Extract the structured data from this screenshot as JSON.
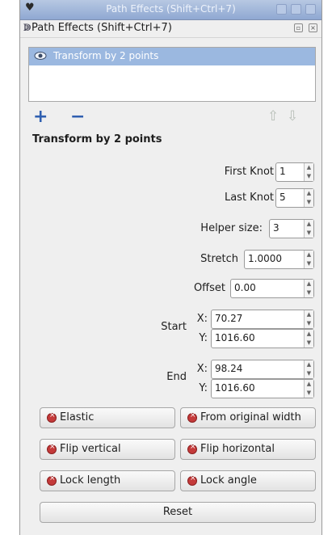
{
  "window": {
    "title": "Path Effects  (Shift+Ctrl+7)"
  },
  "panel": {
    "title": "Path Effects  (Shift+Ctrl+7)"
  },
  "effects_list": {
    "items": [
      {
        "label": "Transform by 2 points"
      }
    ]
  },
  "list_actions": {
    "add": "+",
    "remove": "−"
  },
  "effect": {
    "title": "Transform by 2 points"
  },
  "fields": {
    "first_knot": {
      "label": "First Knot",
      "value": "1"
    },
    "last_knot": {
      "label": "Last Knot",
      "value": "5"
    },
    "helper_size": {
      "label": "Helper size:",
      "value": "3"
    },
    "stretch": {
      "label": "Stretch",
      "value": "1.0000"
    },
    "offset": {
      "label": "Offset",
      "value": "0.00"
    },
    "start": {
      "label": "Start",
      "x_label": "X:",
      "x": "70.27",
      "y_label": "Y:",
      "y": "1016.60"
    },
    "end": {
      "label": "End",
      "x_label": "X:",
      "x": "98.24",
      "y_label": "Y:",
      "y": "1016.60"
    }
  },
  "toggles": {
    "elastic": "Elastic",
    "from_original_width": "From original width",
    "flip_vertical": "Flip vertical",
    "flip_horizontal": "Flip horizontal",
    "lock_length": "Lock length",
    "lock_angle": "Lock angle"
  },
  "reset": "Reset",
  "colors": {
    "selection": "#9bb8e0",
    "toggle_off": "#c43a3a",
    "accent": "#2f5fb0"
  }
}
